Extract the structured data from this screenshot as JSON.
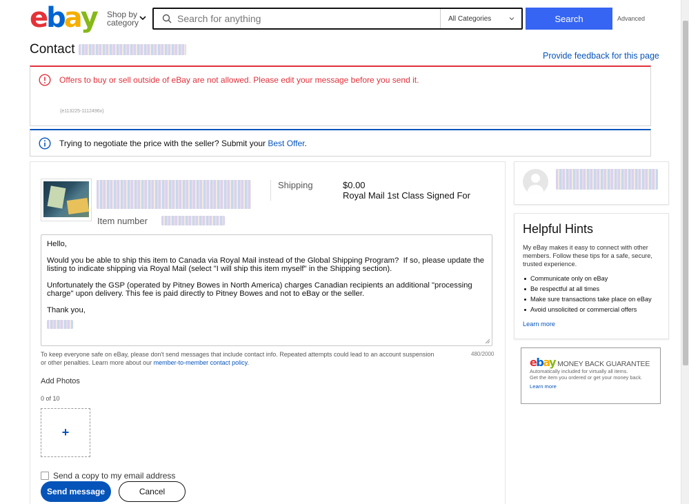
{
  "header": {
    "logo_letters": [
      "e",
      "b",
      "a",
      "y"
    ],
    "logo_colors": [
      "#e53238",
      "#0064d2",
      "#f5af02",
      "#86b817"
    ],
    "shop_by_line1": "Shop by",
    "shop_by_line2": "category",
    "search_placeholder": "Search for anything",
    "category_selected": "All Categories",
    "search_button": "Search",
    "advanced_link": "Advanced"
  },
  "page": {
    "title": "Contact",
    "feedback_link": "Provide feedback for this page"
  },
  "alerts": {
    "error_message": "Offers to buy or sell outside of eBay are not allowed. Please edit your message before you send it.",
    "error_code": "{e113225-1112496x}",
    "info_prefix": "Trying to negotiate the price with the seller? Submit your ",
    "info_link": "Best Offer",
    "info_suffix": "."
  },
  "item": {
    "number_label": "Item number",
    "shipping_label": "Shipping",
    "shipping_price": "$0.00",
    "shipping_method": "Royal Mail 1st Class Signed For"
  },
  "message": {
    "greeting": "Hello,",
    "paragraph1": "Would you be able to ship this item to Canada via Royal Mail instead of the Global Shipping Program?  If so, please update the listing to indicate shipping via Royal Mail (select \"I will ship this item myself\" in the Shipping section).",
    "paragraph2": "Unfortunately the GSP (operated by Pitney Bowes in North America) charges Canadian recipients an additional \"processing charge\" upon delivery. This fee is paid directly to Pitney Bowes and not to eBay or the seller.",
    "closing": "Thank you,",
    "char_count": "480/2000",
    "notice_text": "To keep everyone safe on eBay, please don't send messages that include contact info. Repeated attempts could lead to an account suspension or other penalties. Learn more about our ",
    "notice_link": "member-to-member contact policy",
    "notice_end": "."
  },
  "photos": {
    "label": "Add Photos",
    "count": "0 of 10",
    "add_symbol": "+"
  },
  "actions": {
    "copy_label": "Send a copy to my email address",
    "send_button": "Send message",
    "cancel_button": "Cancel"
  },
  "hints": {
    "title": "Helpful Hints",
    "intro": "My eBay makes it easy to connect with other members. Follow these tips for a safe, secure, trusted experience.",
    "items": [
      "Communicate only on eBay",
      "Be respectful at all times",
      "Make sure transactions take place on eBay",
      "Avoid unsolicited or commercial offers"
    ],
    "learn_more": "Learn more"
  },
  "guarantee": {
    "title": "MONEY BACK GUARANTEE",
    "line1": "Automatically included for virtually all items.",
    "line2": "Get the item you ordered or get your money back.",
    "learn_more": "Learn more"
  },
  "colors": {
    "accent_blue": "#3665f3",
    "link_blue": "#0654ba",
    "error_red": "#e0313b"
  }
}
